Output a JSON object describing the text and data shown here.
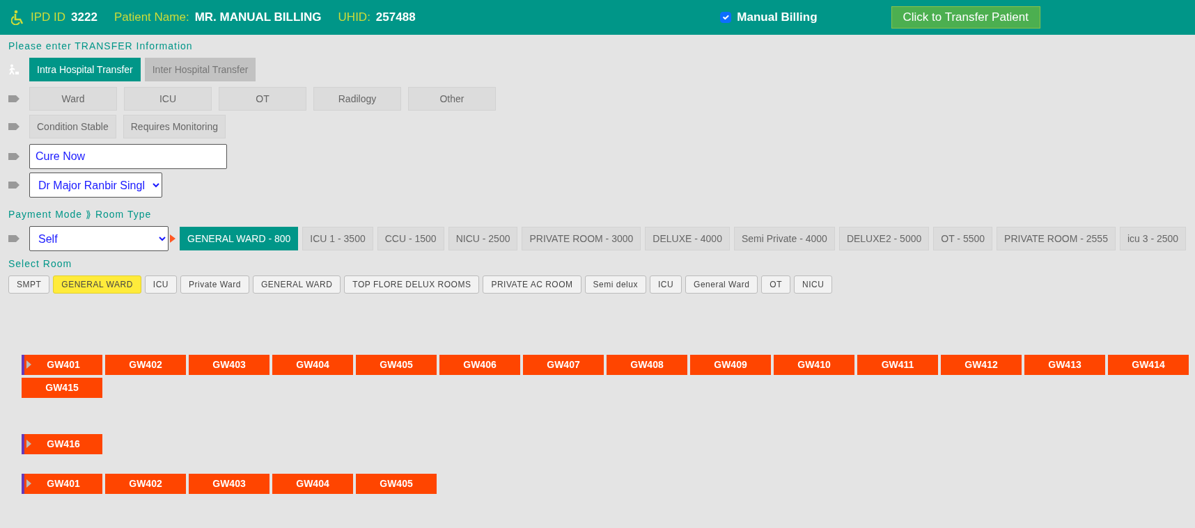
{
  "header": {
    "ipd_label": "IPD ID",
    "ipd_id": "3222",
    "patient_label": "Patient Name:",
    "patient_name": "MR. MANUAL BILLING",
    "uhid_label": "UHID:",
    "uhid": "257488",
    "manual_billing": {
      "label": "Manual Billing",
      "checked": true
    },
    "transfer_button": "Click to Transfer Patient"
  },
  "transfer_heading": "Please enter TRANSFER Information",
  "transfer_types": [
    {
      "label": "Intra Hospital Transfer",
      "selected": true
    },
    {
      "label": "Inter Hospital Transfer",
      "selected": false
    }
  ],
  "departments": [
    {
      "label": "Ward",
      "selected": false
    },
    {
      "label": "ICU",
      "selected": false
    },
    {
      "label": "OT",
      "selected": false
    },
    {
      "label": "Radilogy",
      "selected": false
    },
    {
      "label": "Other",
      "selected": false
    }
  ],
  "conditions": [
    {
      "label": "Condition Stable",
      "selected": false
    },
    {
      "label": "Requires Monitoring",
      "selected": false
    }
  ],
  "hospital_field": {
    "value": "Cure Now"
  },
  "doctor_select": {
    "value": "Dr Major Ranbir Singl"
  },
  "payment_heading": "Payment Mode ⟫ Room Type",
  "payment_select": {
    "value": "Self"
  },
  "room_types": [
    {
      "label": "GENERAL WARD - 800",
      "selected": true
    },
    {
      "label": "ICU 1 - 3500",
      "selected": false
    },
    {
      "label": "CCU - 1500",
      "selected": false
    },
    {
      "label": "NICU - 2500",
      "selected": false
    },
    {
      "label": "PRIVATE ROOM - 3000",
      "selected": false
    },
    {
      "label": "DELUXE - 4000",
      "selected": false
    },
    {
      "label": "Semi Private - 4000",
      "selected": false
    },
    {
      "label": "DELUXE2 - 5000",
      "selected": false
    },
    {
      "label": "OT - 5500",
      "selected": false
    },
    {
      "label": "PRIVATE ROOM - 2555",
      "selected": false
    },
    {
      "label": "icu 3 - 2500",
      "selected": false
    }
  ],
  "select_room_heading": "Select Room",
  "rooms": [
    {
      "label": "SMPT",
      "selected": false
    },
    {
      "label": "GENERAL WARD",
      "selected": true
    },
    {
      "label": "ICU",
      "selected": false
    },
    {
      "label": "Private Ward",
      "selected": false
    },
    {
      "label": "GENERAL WARD",
      "selected": false
    },
    {
      "label": "TOP FLORE DELUX ROOMS",
      "selected": false
    },
    {
      "label": "PRIVATE AC ROOM",
      "selected": false
    },
    {
      "label": "Semi delux",
      "selected": false
    },
    {
      "label": "ICU",
      "selected": false
    },
    {
      "label": "General Ward",
      "selected": false
    },
    {
      "label": "OT",
      "selected": false
    },
    {
      "label": "NICU",
      "selected": false
    }
  ],
  "bed_groups": [
    {
      "beds": [
        "GW401",
        "GW402",
        "GW403",
        "GW404",
        "GW405",
        "GW406",
        "GW407",
        "GW408",
        "GW409",
        "GW410",
        "GW411",
        "GW412",
        "GW413",
        "GW414",
        "GW415"
      ]
    },
    {
      "beds": [
        "GW416"
      ]
    },
    {
      "beds": [
        "GW401",
        "GW402",
        "GW403",
        "GW404",
        "GW405"
      ]
    }
  ]
}
